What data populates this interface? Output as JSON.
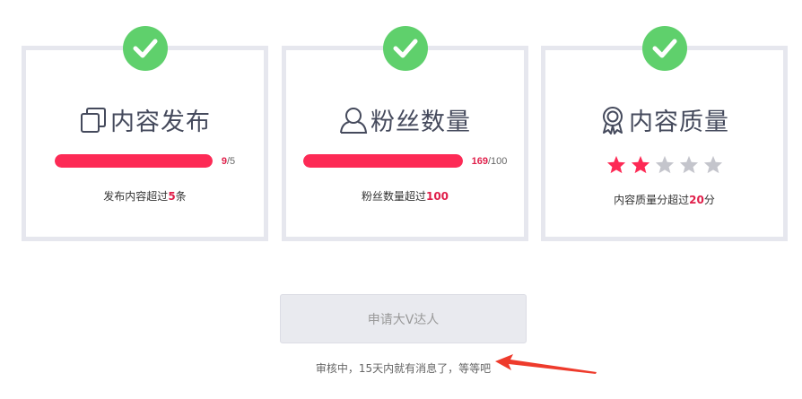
{
  "cards": [
    {
      "title": "内容发布",
      "icon": "copy-icon",
      "progress": {
        "value": "9",
        "sep": "/",
        "target": "5",
        "fraction": 1.0
      },
      "desc_prefix": "发布内容超过",
      "desc_value": "5",
      "desc_suffix": "条"
    },
    {
      "title": "粉丝数量",
      "icon": "user-icon",
      "progress": {
        "value": "169",
        "sep": "/",
        "target": "100",
        "fraction": 1.0
      },
      "desc_prefix": "粉丝数量超过",
      "desc_value": "100",
      "desc_suffix": ""
    },
    {
      "title": "内容质量",
      "icon": "award-icon",
      "rating": {
        "filled": 2,
        "total": 5
      },
      "desc_prefix": "内容质量分超过",
      "desc_value": "20",
      "desc_suffix": "分"
    }
  ],
  "apply_button": {
    "label": "申请大V达人",
    "disabled": true
  },
  "review_note": "审核中，15天内就有消息了，等等吧",
  "colors": {
    "accent": "#fd2a55",
    "check_green": "#5fd06c",
    "card_border": "#e6e7ee",
    "star_empty": "#c4c5cc",
    "arrow": "#ee3b2c"
  }
}
